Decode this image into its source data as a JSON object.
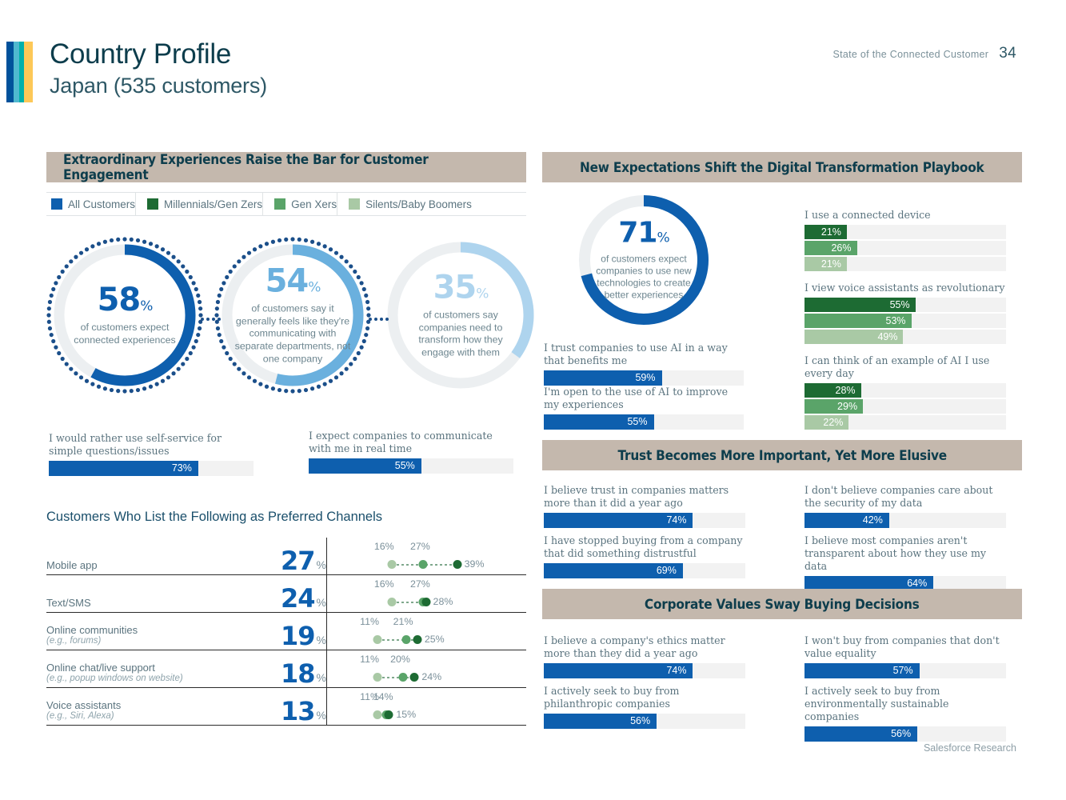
{
  "header": {
    "title": "Country Profile",
    "subtitle": "Japan (535 customers)",
    "report_name": "State of the Connected Customer",
    "page_number": "34"
  },
  "footer": {
    "source": "Salesforce Research"
  },
  "colors": {
    "brand_dark_blue": "#00519b",
    "brand_light_blue": "#4fb8cf",
    "brand_teal": "#00b0ac",
    "brand_yellow": "#fdc858",
    "banner_bg": "#c4b8ad",
    "bar_blue": "#0e5fae",
    "green_millennials": "#1d6b33",
    "green_genx": "#5aa469",
    "green_silents": "#a9c9a5",
    "donut_1": "#0e5fae",
    "donut_2": "#6ab0de",
    "donut_3": "#aed4ee",
    "track": "#f2f2f2"
  },
  "sections": {
    "engagement": {
      "banner": "Extraordinary Experiences Raise the Bar for Customer Engagement"
    },
    "digital": {
      "banner": "New Expectations Shift the Digital Transformation Playbook"
    },
    "trust": {
      "banner": "Trust Becomes More Important, Yet More Elusive"
    },
    "values": {
      "banner": "Corporate Values Sway Buying Decisions"
    }
  },
  "legend": [
    {
      "label": "All Customers",
      "color": "#0e5fae"
    },
    {
      "label": "Millennials/Gen Zers",
      "color": "#1d6b33"
    },
    {
      "label": "Gen Xers",
      "color": "#5aa469"
    },
    {
      "label": "Silents/Baby Boomers",
      "color": "#a9c9a5"
    }
  ],
  "chart_data": [
    {
      "type": "pie",
      "name": "connected-experiences-donut",
      "title": "of customers expect connected experiences",
      "value": 58,
      "value_label": "58",
      "pct_symbol": "%",
      "color": "#0e5fae",
      "track_color": "#eceff1",
      "dotted_ring": true,
      "dotted_ring_color": "#1b4f8a"
    },
    {
      "type": "pie",
      "name": "separate-departments-donut",
      "title": "of customers say it generally feels like they're communicating with separate departments, not one company",
      "value": 54,
      "value_label": "54",
      "pct_symbol": "%",
      "color": "#6ab0de",
      "track_color": "#eceff1",
      "dotted_ring": true,
      "dotted_ring_color": "#1b4f8a"
    },
    {
      "type": "pie",
      "name": "transform-engagement-donut",
      "title": "of customers say companies need to transform how they engage with them",
      "value": 35,
      "value_label": "35",
      "pct_symbol": "%",
      "color": "#aed4ee",
      "track_color": "#eceff1",
      "dotted_ring": false
    },
    {
      "type": "pie",
      "name": "new-technologies-donut",
      "title": "of customers expect companies to use new technologies to create better experiences",
      "value": 71,
      "value_label": "71",
      "pct_symbol": "%",
      "color": "#0e5fae",
      "track_color": "#eceff1",
      "dotted_ring": false
    },
    {
      "type": "bar",
      "name": "engagement-bars",
      "orientation": "horizontal",
      "xlim": [
        0,
        100
      ],
      "categories": [
        "I would rather use self-service for simple questions/issues",
        "I expect companies to communicate with me in real time"
      ],
      "values": [
        73,
        55
      ],
      "value_labels": [
        "73%",
        "55%"
      ],
      "color": "#0e5fae"
    },
    {
      "type": "bar",
      "name": "ai-bars",
      "orientation": "horizontal",
      "xlim": [
        0,
        100
      ],
      "categories": [
        "I trust companies to use AI in a way that benefits me",
        "I'm open to the use of AI to improve my experiences"
      ],
      "values": [
        59,
        55
      ],
      "value_labels": [
        "59%",
        "55%"
      ],
      "color": "#0e5fae"
    },
    {
      "type": "bar",
      "name": "generational-green-bars",
      "orientation": "horizontal",
      "xlim": [
        0,
        100
      ],
      "categories": [
        "I use a connected device",
        "I view voice assistants as revolutionary",
        "I can think of an example of AI I use every day"
      ],
      "series": [
        {
          "name": "Millennials/Gen Zers",
          "color": "#1d6b33",
          "values": [
            21,
            55,
            28
          ]
        },
        {
          "name": "Gen Xers",
          "color": "#5aa469",
          "values": [
            26,
            53,
            29
          ]
        },
        {
          "name": "Silents/Baby Boomers",
          "color": "#a9c9a5",
          "values": [
            21,
            49,
            22
          ]
        }
      ]
    },
    {
      "type": "bar",
      "name": "trust-bars",
      "orientation": "horizontal",
      "xlim": [
        0,
        100
      ],
      "categories": [
        "I believe trust in companies matters more than it did a year ago",
        "I don't believe companies care about the security of my data",
        "I have stopped buying from a company that did something distrustful",
        "I believe most companies aren't transparent about how they use my data"
      ],
      "values": [
        74,
        42,
        69,
        64
      ],
      "value_labels": [
        "74%",
        "42%",
        "69%",
        "64%"
      ],
      "color": "#0e5fae"
    },
    {
      "type": "bar",
      "name": "values-bars",
      "orientation": "horizontal",
      "xlim": [
        0,
        100
      ],
      "categories": [
        "I believe a company's ethics matter more than they did a year ago",
        "I won't buy from companies that don't value equality",
        "I actively seek to buy from philanthropic companies",
        "I actively seek to buy from environmentally sustainable companies"
      ],
      "values": [
        74,
        57,
        56,
        56
      ],
      "value_labels": [
        "74%",
        "57%",
        "56%",
        "56%"
      ],
      "color": "#0e5fae"
    },
    {
      "type": "scatter",
      "name": "preferred-channels-dotplot",
      "title": "Customers Who List the Following as Preferred Channels",
      "xlim": [
        0,
        45
      ],
      "categories": [
        "Mobile app",
        "Text/SMS",
        "Online communities",
        "Online chat/live support",
        "Voice assistants"
      ],
      "all_customers": [
        27,
        24,
        19,
        18,
        13
      ],
      "series": [
        {
          "name": "Silents/Baby Boomers",
          "color": "#a9c9a5",
          "values": [
            16,
            16,
            11,
            11,
            11
          ]
        },
        {
          "name": "Gen Xers",
          "color": "#5aa469",
          "values": [
            27,
            27,
            21,
            20,
            14
          ]
        },
        {
          "name": "Millennials/Gen Zers",
          "color": "#1d6b33",
          "values": [
            39,
            28,
            25,
            24,
            15
          ]
        }
      ]
    }
  ],
  "donuts_left": [
    {
      "num": "58",
      "pct": "%",
      "desc": "of customers expect connected experiences"
    },
    {
      "num": "54",
      "pct": "%",
      "desc": "of customers say it generally feels like they're communicating with separate departments, not one company"
    },
    {
      "num": "35",
      "pct": "%",
      "desc": "of customers say companies need to transform how they engage with them"
    }
  ],
  "donut_right": {
    "num": "71",
    "pct": "%",
    "desc": "of customers expect companies to use new technologies to create better experiences"
  },
  "engagement_bars": [
    {
      "label": "I would rather use self-service for simple questions/issues",
      "value": 73,
      "value_label": "73%"
    },
    {
      "label": "I expect companies to communicate with me in real time",
      "value": 55,
      "value_label": "55%"
    }
  ],
  "ai_bars": [
    {
      "label": "I trust companies to use AI in a way that benefits me",
      "value": 59,
      "value_label": "59%"
    },
    {
      "label": "I'm open to the use of AI to improve my experiences",
      "value": 55,
      "value_label": "55%"
    }
  ],
  "green_groups": [
    {
      "label": "I use a connected device",
      "bars": [
        {
          "value": 21,
          "value_label": "21%",
          "color": "#1d6b33"
        },
        {
          "value": 26,
          "value_label": "26%",
          "color": "#5aa469"
        },
        {
          "value": 21,
          "value_label": "21%",
          "color": "#a9c9a5"
        }
      ]
    },
    {
      "label": "I view voice assistants as revolutionary",
      "bars": [
        {
          "value": 55,
          "value_label": "55%",
          "color": "#1d6b33"
        },
        {
          "value": 53,
          "value_label": "53%",
          "color": "#5aa469"
        },
        {
          "value": 49,
          "value_label": "49%",
          "color": "#a9c9a5"
        }
      ]
    },
    {
      "label": "I can think of an example of AI I use every day",
      "bars": [
        {
          "value": 28,
          "value_label": "28%",
          "color": "#1d6b33"
        },
        {
          "value": 29,
          "value_label": "29%",
          "color": "#5aa469"
        },
        {
          "value": 22,
          "value_label": "22%",
          "color": "#a9c9a5"
        }
      ]
    }
  ],
  "trust_bars": [
    {
      "label": "I believe trust in companies matters more than it did a year ago",
      "value": 74,
      "value_label": "74%"
    },
    {
      "label": "I don't believe companies care about the security of my data",
      "value": 42,
      "value_label": "42%"
    },
    {
      "label": "I have stopped buying from a company that did something distrustful",
      "value": 69,
      "value_label": "69%"
    },
    {
      "label": "I believe most companies aren't transparent about how they use my data",
      "value": 64,
      "value_label": "64%"
    }
  ],
  "values_bars": [
    {
      "label": "I believe a company's ethics matter more than they did a year ago",
      "value": 74,
      "value_label": "74%"
    },
    {
      "label": "I won't buy from companies that don't value equality",
      "value": 57,
      "value_label": "57%"
    },
    {
      "label": "I actively seek to buy from philanthropic companies",
      "value": 56,
      "value_label": "56%"
    },
    {
      "label": "I actively seek to buy from environmentally sustainable companies",
      "value": 56,
      "value_label": "56%"
    }
  ],
  "channels": {
    "title": "Customers Who List the Following as Preferred Channels",
    "rows": [
      {
        "name": "Mobile app",
        "sub": "",
        "big": "27",
        "pct": "%",
        "low_label": "16%",
        "mid_label": "27%",
        "high_label": "39%",
        "low": 16,
        "mid": 27,
        "high": 39
      },
      {
        "name": "Text/SMS",
        "sub": "",
        "big": "24",
        "pct": "%",
        "low_label": "16%",
        "mid_label": "27%",
        "high_label": "28%",
        "low": 16,
        "mid": 27,
        "high": 28
      },
      {
        "name": "Online communities",
        "sub": "(e.g.,  forums)",
        "big": "19",
        "pct": "%",
        "low_label": "11%",
        "mid_label": "21%",
        "high_label": "25%",
        "low": 11,
        "mid": 21,
        "high": 25
      },
      {
        "name": "Online chat/live support",
        "sub": "(e.g., popup windows on website)",
        "big": "18",
        "pct": "%",
        "low_label": "11%",
        "mid_label": "20%",
        "high_label": "24%",
        "low": 11,
        "mid": 20,
        "high": 24
      },
      {
        "name": "Voice assistants",
        "sub": "(e.g., Siri, Alexa)",
        "big": "13",
        "pct": "%",
        "low_label": "11%",
        "mid_label": "14%",
        "high_label": "15%",
        "low": 11,
        "mid": 14,
        "high": 15
      }
    ]
  }
}
